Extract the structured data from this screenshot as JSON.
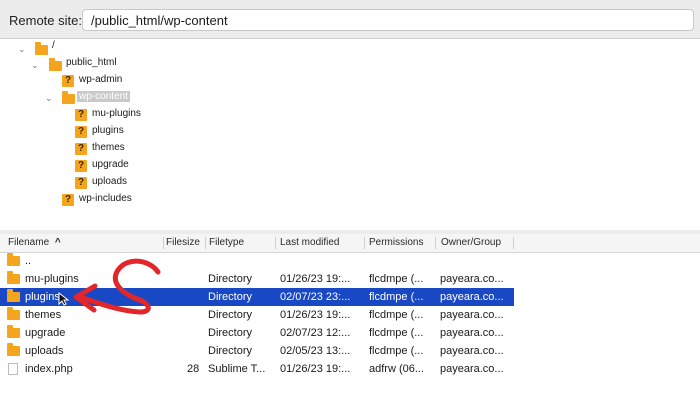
{
  "remote_site": {
    "label": "Remote site:",
    "path": "/public_html/wp-content"
  },
  "tree": [
    {
      "label": "/",
      "icon": "folder-icon",
      "expanded": true
    },
    {
      "label": "public_html",
      "icon": "folder-icon",
      "expanded": true
    },
    {
      "label": "wp-admin",
      "icon": "question-folder-icon"
    },
    {
      "label": "wp-content",
      "icon": "folder-icon",
      "expanded": true,
      "selected": true
    },
    {
      "label": "mu-plugins",
      "icon": "question-folder-icon"
    },
    {
      "label": "plugins",
      "icon": "question-folder-icon"
    },
    {
      "label": "themes",
      "icon": "question-folder-icon"
    },
    {
      "label": "upgrade",
      "icon": "question-folder-icon"
    },
    {
      "label": "uploads",
      "icon": "question-folder-icon"
    },
    {
      "label": "wp-includes",
      "icon": "question-folder-icon"
    }
  ],
  "list": {
    "columns": {
      "filename": "Filename",
      "filesize": "Filesize",
      "filetype": "Filetype",
      "modified": "Last modified",
      "permissions": "Permissions",
      "owner": "Owner/Group"
    },
    "sort_icon": "sort-ascending-chevron",
    "rows": [
      {
        "name": "..",
        "size": "",
        "type": "",
        "modified": "",
        "perms": "",
        "owner": "",
        "icon": "folder-icon"
      },
      {
        "name": "mu-plugins",
        "size": "",
        "type": "Directory",
        "modified": "01/26/23 19:...",
        "perms": "flcdmpe (...",
        "owner": "payeara.co...",
        "icon": "folder-icon"
      },
      {
        "name": "plugins",
        "size": "",
        "type": "Directory",
        "modified": "02/07/23 23:...",
        "perms": "flcdmpe (...",
        "owner": "payeara.co...",
        "icon": "folder-icon",
        "selected": true
      },
      {
        "name": "themes",
        "size": "",
        "type": "Directory",
        "modified": "01/26/23 19:...",
        "perms": "flcdmpe (...",
        "owner": "payeara.co...",
        "icon": "folder-icon"
      },
      {
        "name": "upgrade",
        "size": "",
        "type": "Directory",
        "modified": "02/07/23 12:...",
        "perms": "flcdmpe (...",
        "owner": "payeara.co...",
        "icon": "folder-icon"
      },
      {
        "name": "uploads",
        "size": "",
        "type": "Directory",
        "modified": "02/05/23 13:...",
        "perms": "flcdmpe (...",
        "owner": "payeara.co...",
        "icon": "folder-icon"
      },
      {
        "name": "index.php",
        "size": "28",
        "type": "Sublime T...",
        "modified": "01/26/23 19:...",
        "perms": "adfrw (06...",
        "owner": "payeara.co...",
        "icon": "file-icon"
      }
    ]
  },
  "colors": {
    "folder": "#f4a41d",
    "selection": "#1948c4",
    "annotation": "#e3262a"
  }
}
